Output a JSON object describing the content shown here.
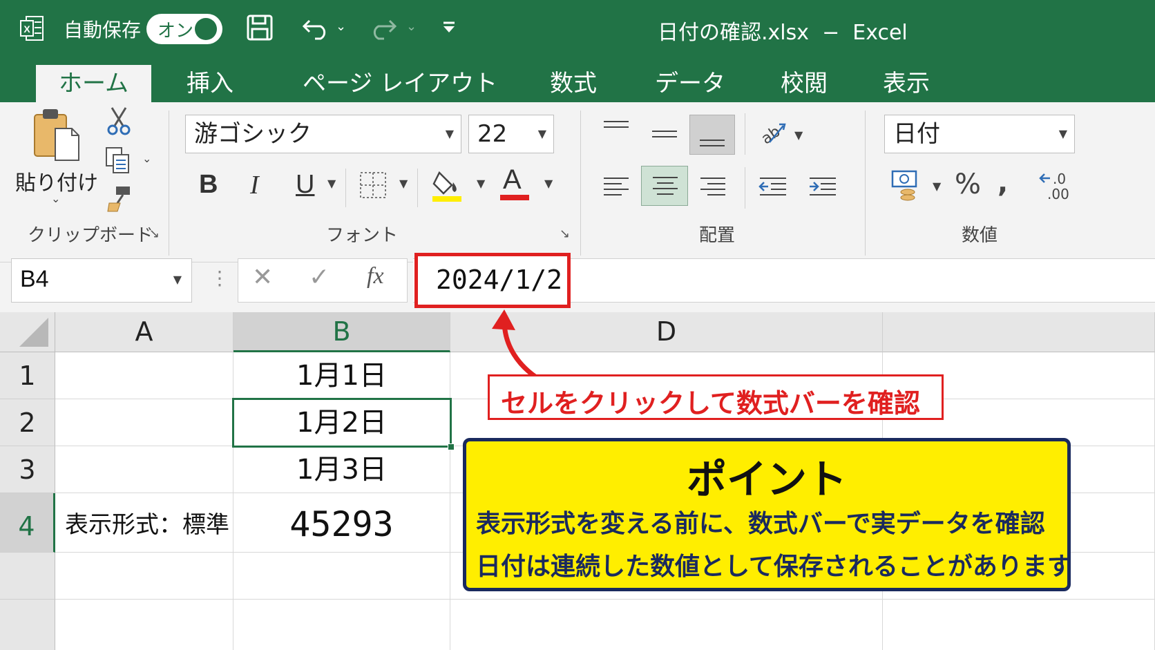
{
  "window": {
    "autosave_label": "自動保存",
    "autosave_state": "オン",
    "title": "日付の確認.xlsx  −  Excel"
  },
  "tabs": [
    "ホーム",
    "挿入",
    "ページ レイアウト",
    "数式",
    "データ",
    "校閲",
    "表示"
  ],
  "ribbon": {
    "clipboard": {
      "paste_label": "貼り付け",
      "group_label": "クリップボード"
    },
    "font": {
      "font_name": "游ゴシック",
      "font_size": "22",
      "group_label": "フォント",
      "bold": "B",
      "italic": "I",
      "underline": "U",
      "font_color": "A"
    },
    "alignment": {
      "group_label": "配置"
    },
    "number": {
      "format": "日付",
      "percent": "%",
      "comma": ",",
      "group_label": "数値",
      "decimal": "←.0\n.00"
    }
  },
  "formula_bar": {
    "name_box": "B4",
    "fx": "fx",
    "value": "2024/1/2"
  },
  "grid": {
    "columns": [
      "A",
      "B",
      "D"
    ],
    "rows": [
      "1",
      "2",
      "3",
      "4"
    ],
    "cells": {
      "B1": "1月1日",
      "B2": "1月2日",
      "B3": "1月3日",
      "A4": "表示形式：標準",
      "B4": "45293"
    }
  },
  "annotations": {
    "callout": "セルをクリックして数式バーを確認",
    "point_title": "ポイント",
    "point_line1": "表示形式を変える前に、数式バーで実データを確認",
    "point_line2": "日付は連続した数値として保存されることがあります"
  },
  "colors": {
    "excel_green": "#217346",
    "callout_red": "#e02020",
    "point_yellow": "#ffee00",
    "point_border": "#1a2a5e"
  }
}
